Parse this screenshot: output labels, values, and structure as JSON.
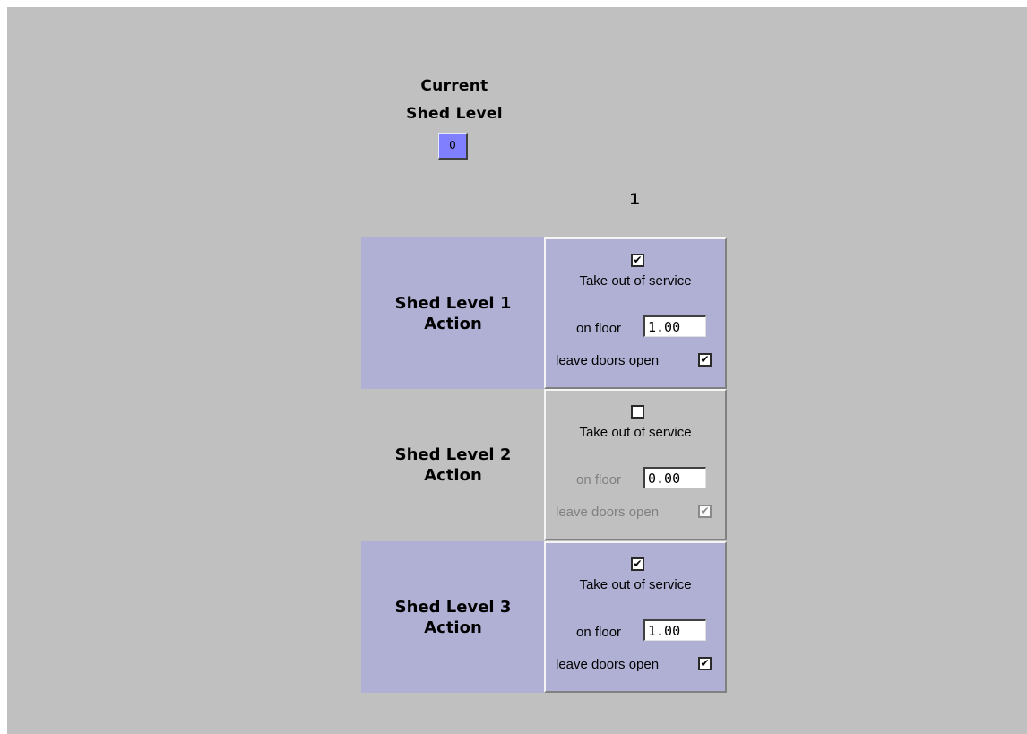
{
  "current_shed": {
    "title_line1": "Current",
    "title_line2": "Shed Level",
    "value": "0"
  },
  "column_header": "1",
  "rows": [
    {
      "label_line1": "Shed Level 1",
      "label_line2": "Action",
      "take_out_checked": "✔",
      "take_out_label": "Take out of service",
      "floor_label": "on floor",
      "floor_value": "1.00",
      "doors_label": "leave doors open",
      "doors_checked": "✔",
      "enabled": true
    },
    {
      "label_line1": "Shed Level 2",
      "label_line2": "Action",
      "take_out_checked": "",
      "take_out_label": "Take out of service",
      "floor_label": "on floor",
      "floor_value": "0.00",
      "doors_label": "leave doors open",
      "doors_checked": "✔",
      "enabled": false
    },
    {
      "label_line1": "Shed Level 3",
      "label_line2": "Action",
      "take_out_checked": "✔",
      "take_out_label": "Take out of service",
      "floor_label": "on floor",
      "floor_value": "1.00",
      "doors_label": "leave doors open",
      "doors_checked": "✔",
      "enabled": true
    }
  ]
}
